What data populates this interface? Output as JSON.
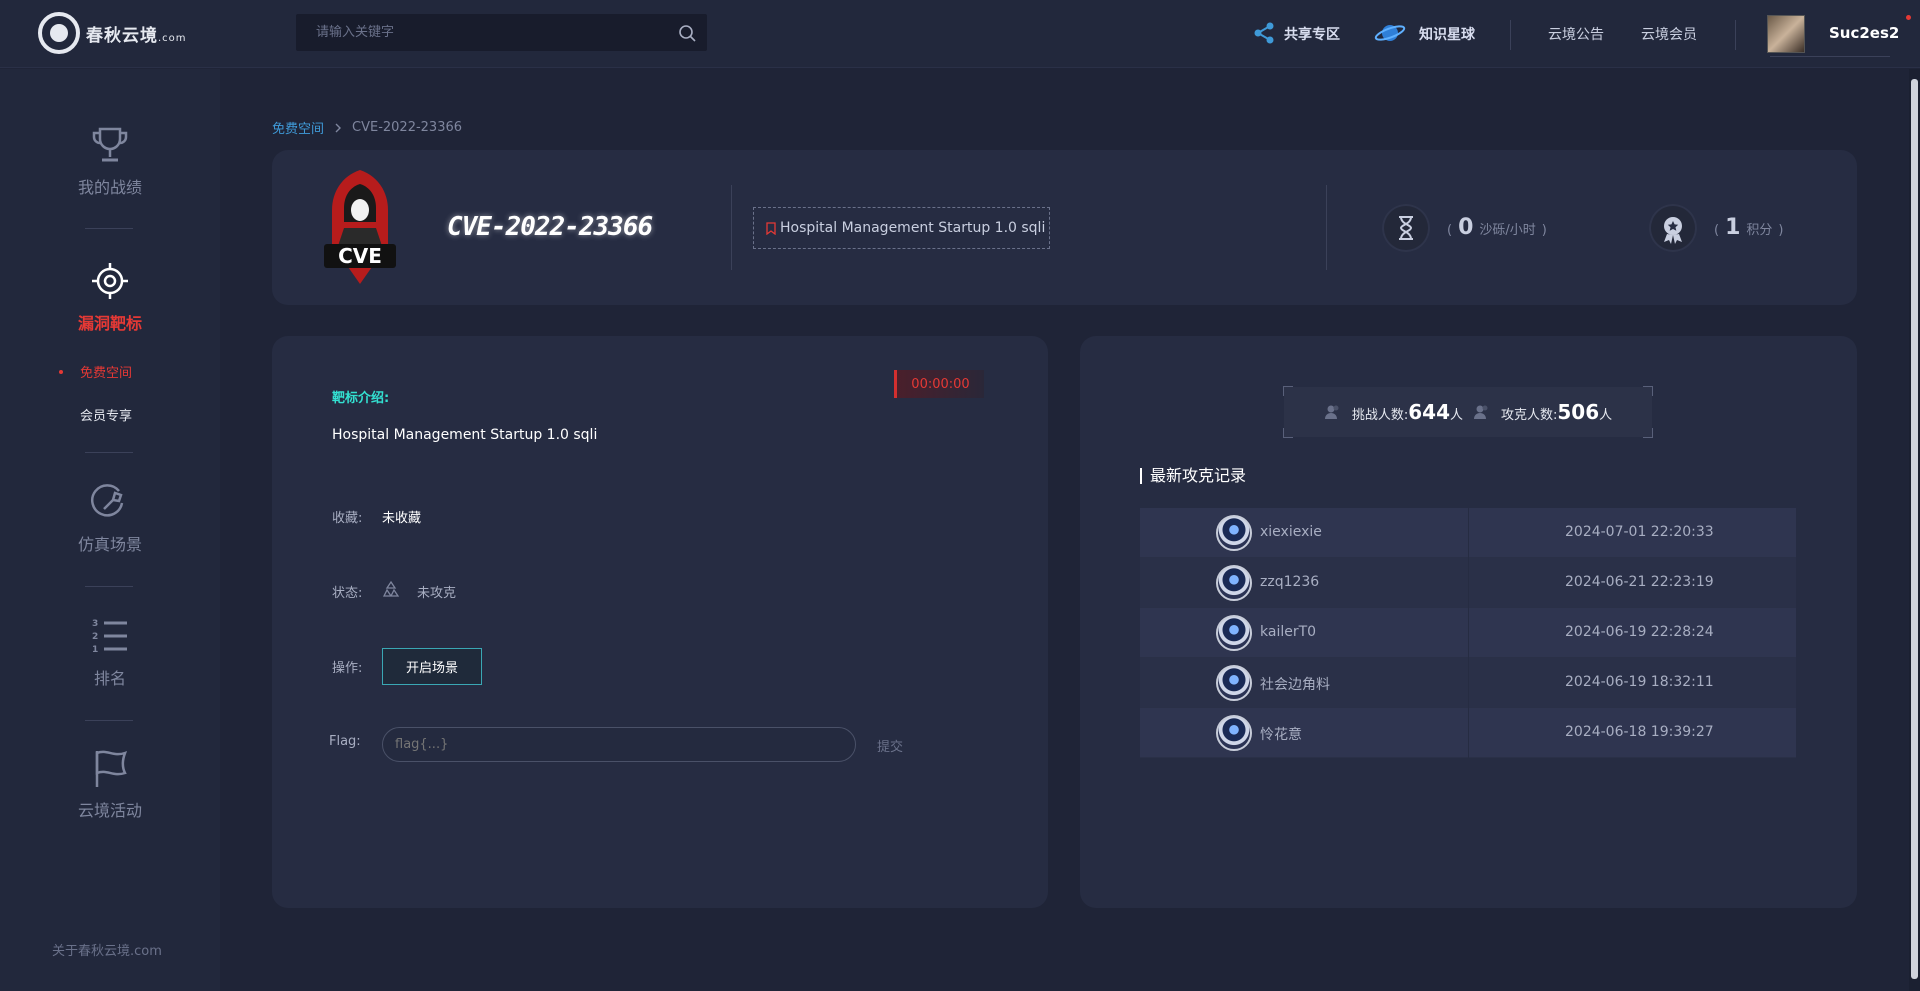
{
  "header": {
    "logo_text": "春秋云境",
    "logo_suffix": ".com",
    "search_placeholder": "请输入关键字",
    "nav": {
      "share": "共享专区",
      "knowledge": "知识星球",
      "notice": "云境公告",
      "member": "云境会员"
    },
    "username": "Suc2es2"
  },
  "sidebar": {
    "items": [
      {
        "label": "我的战绩",
        "icon": "trophy-icon"
      },
      {
        "label": "漏洞靶标",
        "icon": "target-icon"
      },
      {
        "label": "仿真场景",
        "icon": "simulation-icon"
      },
      {
        "label": "排名",
        "icon": "ranking-list-icon"
      },
      {
        "label": "云境活动",
        "icon": "flag-icon"
      }
    ],
    "sub_items": [
      "免费空间",
      "会员专享"
    ],
    "footer": "关于春秋云境.com"
  },
  "breadcrumb": {
    "parent": "免费空间",
    "current": "CVE-2022-23366"
  },
  "target": {
    "title": "CVE-2022-23366",
    "tag": "Hospital Management Startup 1.0 sqli",
    "sand_value": "0",
    "sand_unit": "沙砾/小时",
    "points_value": "1",
    "points_unit": "积分",
    "bracket_open": "(",
    "bracket_close": ")"
  },
  "detail": {
    "timer": "00:00:00",
    "intro_label": "靶标介绍:",
    "intro_text": "Hospital Management Startup 1.0 sqli",
    "favorite_label": "收藏:",
    "favorite_value": "未收藏",
    "status_label": "状态:",
    "status_value": "未攻克",
    "action_label": "操作:",
    "start_button": "开启场景",
    "flag_label": "Flag:",
    "flag_placeholder": "flag{...}",
    "submit": "提交"
  },
  "stats": {
    "challengers_label": "挑战人数:",
    "challengers": "644",
    "solvers_label": "攻克人数:",
    "solvers": "506",
    "unit": "人"
  },
  "records": {
    "title": "最新攻克记录",
    "rows": [
      {
        "name": "xiexiexie",
        "time": "2024-07-01 22:20:33"
      },
      {
        "name": "zzq1236",
        "time": "2024-06-21 22:23:19"
      },
      {
        "name": "kailerT0",
        "time": "2024-06-19 22:28:24"
      },
      {
        "name": "社会边角料",
        "time": "2024-06-19 18:32:11"
      },
      {
        "name": "怜花意",
        "time": "2024-06-18 19:39:27"
      }
    ]
  },
  "colors": {
    "accent_red": "#e53935",
    "accent_cyan": "#33e0d1",
    "link_blue": "#3f9ad8"
  }
}
